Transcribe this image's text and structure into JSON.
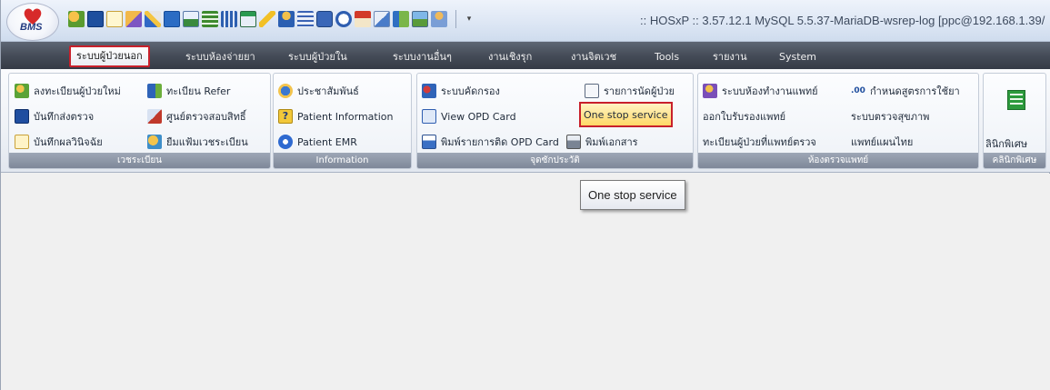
{
  "app": {
    "logo_text": "BMS",
    "window_title": ":: HOSxP :: 3.57.12.1 MySQL 5.5.37-MariaDB-wsrep-log [ppc@192.168.1.39/"
  },
  "tabs": [
    {
      "label": "ระบบผู้ป่วยนอก"
    },
    {
      "label": "ระบบห้องจ่ายยา"
    },
    {
      "label": "ระบบผู้ป่วยใน"
    },
    {
      "label": "ระบบงานอื่นๆ"
    },
    {
      "label": "งานเชิงรุก"
    },
    {
      "label": "งานจิตเวช"
    },
    {
      "label": "Tools"
    },
    {
      "label": "รายงาน"
    },
    {
      "label": "System"
    }
  ],
  "groups": {
    "registration": {
      "label": "เวชระเบียน",
      "items": [
        {
          "label": "ลงทะเบียนผู้ป่วยใหม่",
          "icon": "add-patient-icon"
        },
        {
          "label": "ทะเบียน Refer",
          "icon": "refer-arrow-icon"
        },
        {
          "label": "บันทึกส่งตรวจ",
          "icon": "send-exam-icon"
        },
        {
          "label": "ศูนย์ตรวจสอบสิทธิ์",
          "icon": "rights-check-icon"
        },
        {
          "label": "บันทึกผลวินิจฉัย",
          "icon": "diagnosis-icon"
        },
        {
          "label": "ยืมแฟ้มเวชระเบียน",
          "icon": "borrow-folder-icon"
        }
      ]
    },
    "information": {
      "label": "Information",
      "items": [
        {
          "label": "ประชาสัมพันธ์",
          "icon": "info-icon"
        },
        {
          "label": "Patient Information",
          "icon": "question-icon"
        },
        {
          "label": "Patient EMR",
          "icon": "emr-icon"
        }
      ]
    },
    "service_point": {
      "label": "จุดซักประวัติ",
      "items": [
        {
          "label": "ระบบคัดกรอง",
          "icon": "screening-icon"
        },
        {
          "label": "รายการนัดผู้ป่วย",
          "icon": "appointment-icon"
        },
        {
          "label": "View OPD Card",
          "icon": "opd-card-icon"
        },
        {
          "label": "One stop service",
          "icon": "",
          "highlighted": true
        },
        {
          "label": "พิมพ์รายการติด OPD Card",
          "icon": "print-list-icon"
        },
        {
          "label": "พิมพ์เอกสาร",
          "icon": "printer-icon"
        }
      ]
    },
    "exam_room": {
      "label": "ห้องตรวจแพทย์",
      "items": [
        {
          "label": "ระบบห้องทำงานแพทย์",
          "icon": "doctor-room-icon"
        },
        {
          "label": "กำหนดสูตรการใช้ยา",
          "icon": "decimal-icon"
        },
        {
          "label": "ออกใบรับรองแพทย์",
          "icon": ""
        },
        {
          "label": "ระบบตรวจสุขภาพ",
          "icon": ""
        },
        {
          "label": "ทะเบียนผู้ป่วยที่แพทย์ตรวจ",
          "icon": ""
        },
        {
          "label": "แพทย์แผนไทย",
          "icon": ""
        }
      ]
    },
    "special_clinic": {
      "label": "คลินิกพิเศษ",
      "items": [
        {
          "label": "ลินิกพิเศษ",
          "icon": "clinic-grid-icon"
        }
      ]
    }
  },
  "tooltip": {
    "text": "One stop service"
  },
  "colors": {
    "accent_red": "#c8202b",
    "tab_bar": "#454c58",
    "highlight": "#ffd866"
  }
}
